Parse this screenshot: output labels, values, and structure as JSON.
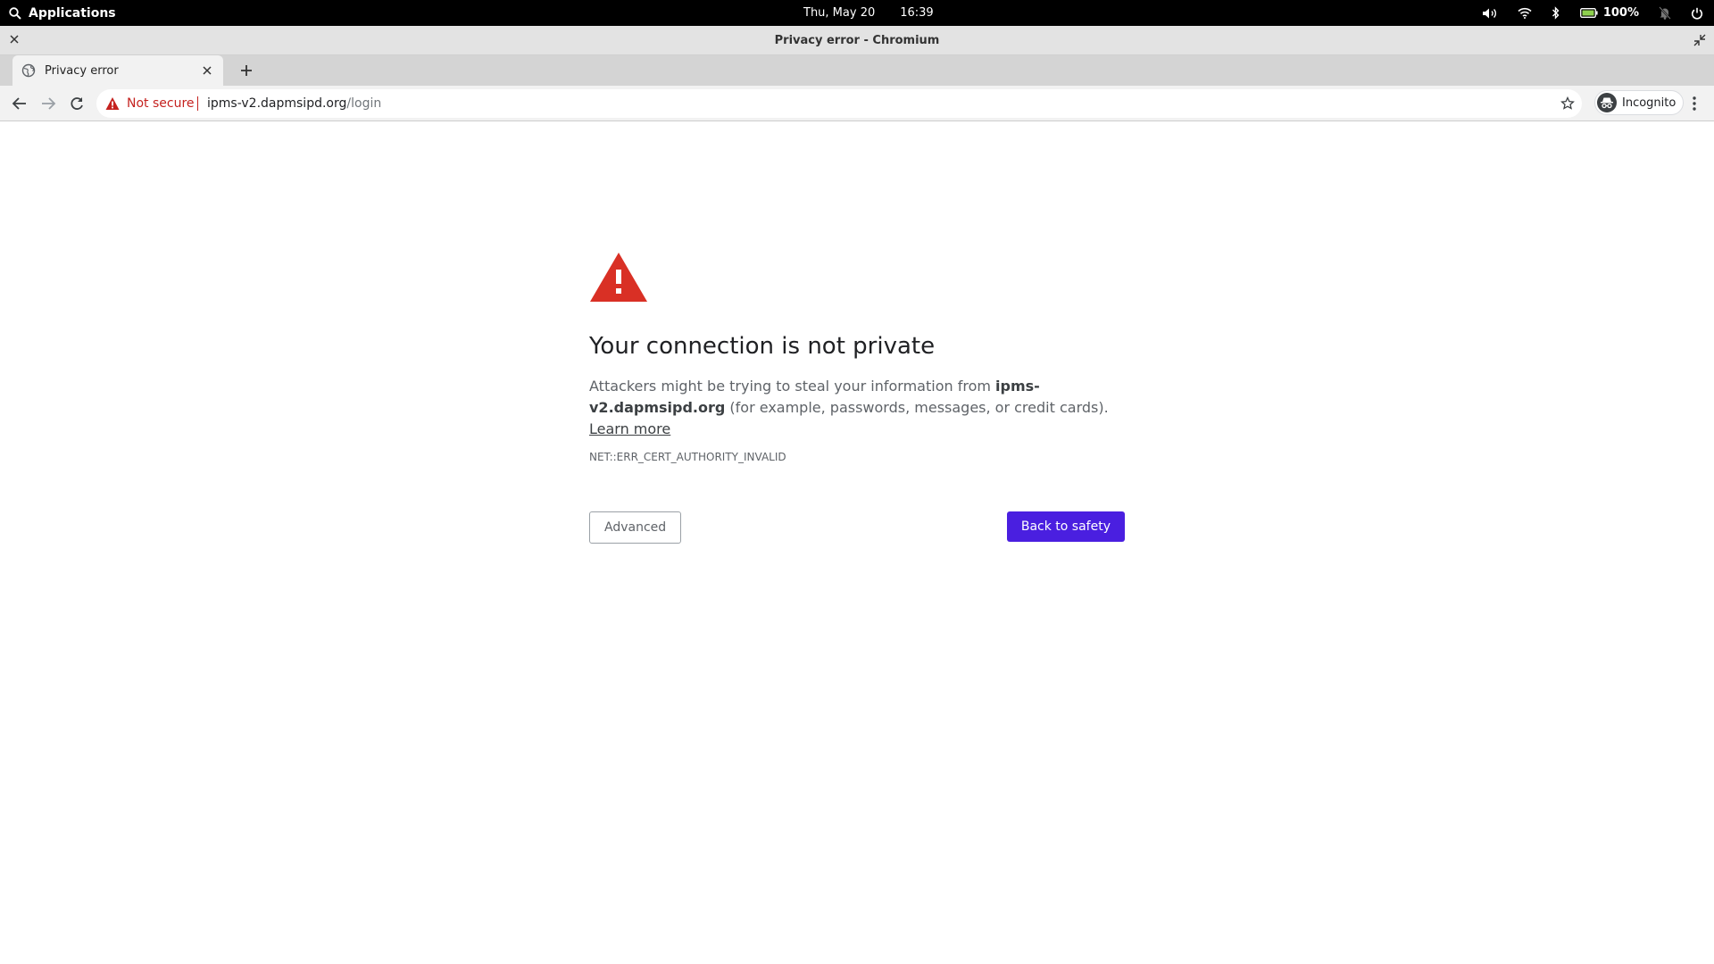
{
  "system_panel": {
    "apps_label": "Applications",
    "date": "Thu, May 20",
    "time": "16:39",
    "battery": "100%",
    "icons": [
      "search-icon",
      "volume-icon",
      "wifi-icon",
      "bluetooth-icon",
      "battery-icon",
      "notifications-off-icon",
      "power-icon"
    ]
  },
  "window": {
    "title": "Privacy error - Chromium"
  },
  "tabs": [
    {
      "title": "Privacy error",
      "icon": "globe-icon"
    }
  ],
  "toolbar": {
    "security_label": "Not secure",
    "url_host": "ipms-v2.dapmsipd.org",
    "url_path": "/login",
    "incognito_label": "Incognito"
  },
  "page": {
    "heading": "Your connection is not private",
    "desc_before": "Attackers might be trying to steal your information from ",
    "desc_domain": "ipms-v2.dapmsipd.org",
    "desc_after": " (for example, passwords, messages, or credit cards). ",
    "learn_more": "Learn more",
    "error_code": "NET::ERR_CERT_AUTHORITY_INVALID",
    "advanced_label": "Advanced",
    "back_label": "Back to safety"
  },
  "colors": {
    "warning_red": "#d93025",
    "not_secure_red": "#c5221f",
    "primary_button": "#4a1fe0"
  }
}
